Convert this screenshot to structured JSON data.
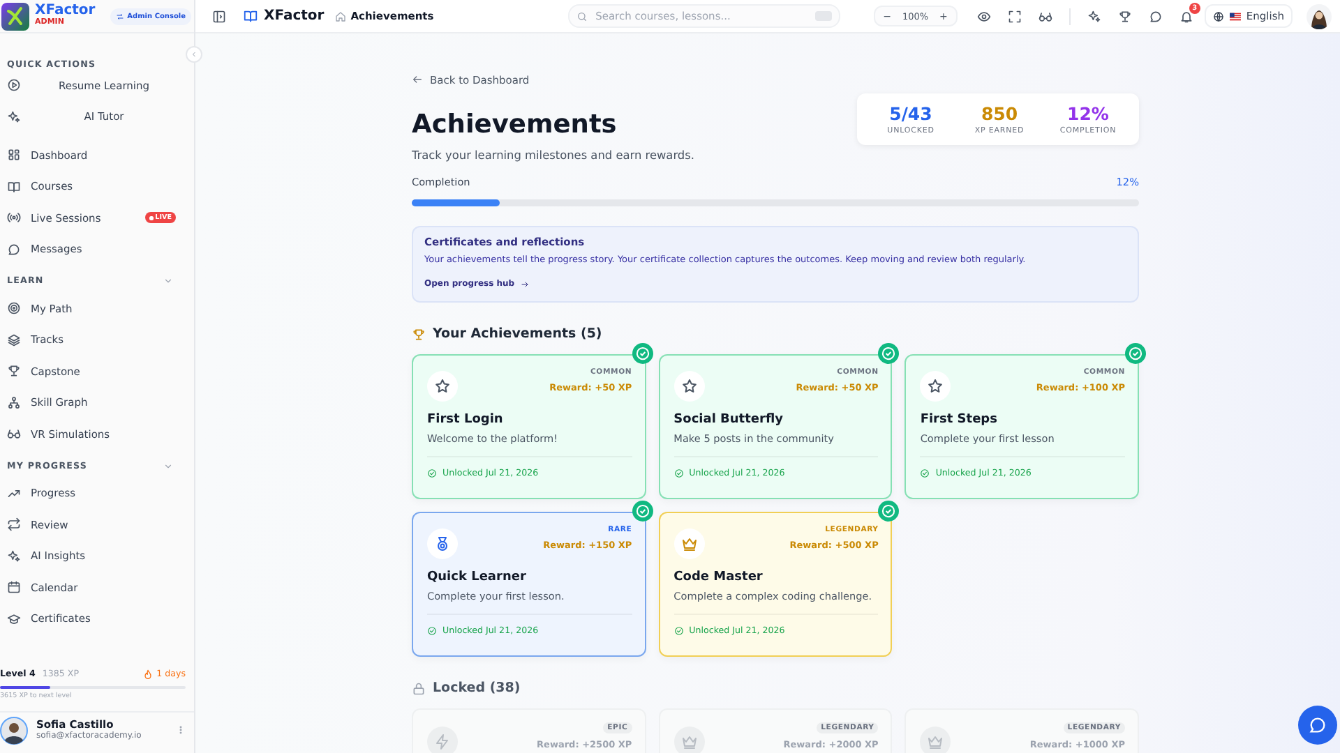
{
  "brand": {
    "name": "XFactor",
    "role": "ADMIN",
    "console_button": "Admin Console"
  },
  "header": {
    "app_name": "XFactor",
    "breadcrumb": "Achievements",
    "search": {
      "placeholder": "Search courses, lessons..."
    },
    "zoom": {
      "minus": "−",
      "value": "100%",
      "plus": "+"
    },
    "notifications": "3",
    "language": "English"
  },
  "sidebar": {
    "quick_actions": {
      "title": "QUICK ACTIONS",
      "items": [
        {
          "label": "Resume Learning"
        },
        {
          "label": "AI Tutor"
        }
      ]
    },
    "main_items": [
      {
        "label": "Dashboard",
        "selected": false
      },
      {
        "label": "Courses",
        "selected": false
      },
      {
        "label": "Live Sessions",
        "selected": false,
        "badge": "LIVE"
      },
      {
        "label": "Messages",
        "selected": false
      }
    ],
    "sections": [
      {
        "title": "LEARN",
        "expanded": true,
        "items": [
          {
            "label": "My Path",
            "selected": false
          },
          {
            "label": "Tracks",
            "selected": false
          },
          {
            "label": "Capstone",
            "selected": false
          },
          {
            "label": "Skill Graph",
            "selected": false
          },
          {
            "label": "VR Simulations",
            "selected": false
          }
        ]
      },
      {
        "title": "MY PROGRESS",
        "expanded": true,
        "items": [
          {
            "label": "Progress",
            "selected": false
          },
          {
            "label": "Review",
            "selected": false
          },
          {
            "label": "AI Insights",
            "selected": false
          },
          {
            "label": "Calendar",
            "selected": false
          },
          {
            "label": "Certificates",
            "selected": false
          }
        ]
      }
    ],
    "level": {
      "label": "Level 4",
      "xp": "1385 XP",
      "streak": "1 days",
      "level": 0.27,
      "next": "3615 XP to next level"
    },
    "user": {
      "name": "Sofia Castillo",
      "email": "sofia@xfactoracademy.io"
    }
  },
  "page": {
    "back_link": "Back to Dashboard",
    "title": "Achievements",
    "subtitle": "Track your learning milestones and earn rewards.",
    "stats": [
      {
        "value": "5/43",
        "label": "UNLOCKED",
        "color": "#2563eb"
      },
      {
        "value": "850",
        "label": "XP EARNED",
        "color": "#ca8a04"
      },
      {
        "value": "12%",
        "label": "COMPLETION",
        "color": "#9333ea"
      }
    ],
    "completion": {
      "label": "Completion",
      "reading": "12%",
      "level": 0.12
    },
    "banner": {
      "title": "Certificates and reflections",
      "text": "Your achievements tell the progress story. Your certificate collection captures the outcomes. Keep moving and review both regularly.",
      "link": "Open progress hub"
    },
    "sections": [
      {
        "title": "Your Achievements (5)",
        "kind": "earned",
        "cards": [
          {
            "kind": "common",
            "rarity": "COMMON",
            "reward": "Reward: +50 XP",
            "name": "First Login",
            "description": "Welcome to the platform!",
            "date": "Unlocked Jul 21, 2026",
            "unlocked": true
          },
          {
            "kind": "common",
            "rarity": "COMMON",
            "reward": "Reward: +50 XP",
            "name": "Social Butterfly",
            "description": "Make 5 posts in the community",
            "date": "Unlocked Jul 21, 2026",
            "unlocked": true
          },
          {
            "kind": "common",
            "rarity": "COMMON",
            "reward": "Reward: +100 XP",
            "name": "First Steps",
            "description": "Complete your first lesson",
            "date": "Unlocked Jul 21, 2026",
            "unlocked": true
          },
          {
            "kind": "rare",
            "rarity": "RARE",
            "reward": "Reward: +150 XP",
            "name": "Quick Learner",
            "description": "Complete your first lesson.",
            "date": "Unlocked Jul 21, 2026",
            "unlocked": true
          },
          {
            "kind": "legendary",
            "rarity": "LEGENDARY",
            "reward": "Reward: +500 XP",
            "name": "Code Master",
            "description": "Complete a complex coding challenge.",
            "date": "Unlocked Jul 21, 2026",
            "unlocked": true
          }
        ]
      },
      {
        "title": "Locked (38)",
        "kind": "locked",
        "cards": [
          {
            "kind": "epic",
            "rarity": "EPIC",
            "reward": "Reward: +2500 XP",
            "unlocked": false
          },
          {
            "kind": "legendary",
            "rarity": "LEGENDARY",
            "reward": "Reward: +2000 XP",
            "unlocked": false
          },
          {
            "kind": "legendary",
            "rarity": "LEGENDARY",
            "reward": "Reward: +1000 XP",
            "unlocked": false
          }
        ]
      }
    ]
  }
}
